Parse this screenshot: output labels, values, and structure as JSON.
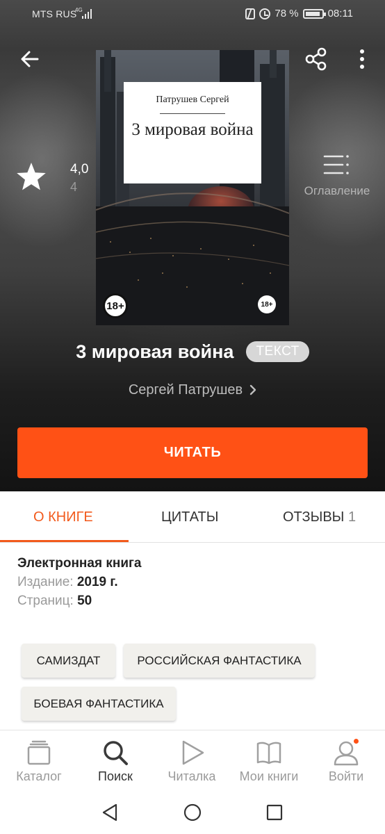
{
  "status_bar": {
    "carrier": "MTS RUS",
    "network": "4G",
    "battery": "78 %",
    "time": "08:11"
  },
  "rating": {
    "value": "4,0",
    "count": "4"
  },
  "toc": {
    "label": "Оглавление"
  },
  "cover": {
    "author": "Патрушев Сергей",
    "title": "3 мировая война",
    "age_badge": "18+",
    "age_badge_small": "18+"
  },
  "book": {
    "title": "3 мировая война",
    "format": "ТЕКСТ",
    "author": "Сергей Патрушев"
  },
  "read_button": "ЧИТАТЬ",
  "tabs": [
    {
      "label": "О КНИГЕ"
    },
    {
      "label": "ЦИТАТЫ"
    },
    {
      "label": "ОТЗЫВЫ",
      "count": "1"
    }
  ],
  "info": {
    "type": "Электронная книга",
    "edition_label": "Издание:",
    "edition_value": "2019 г.",
    "pages_label": "Страниц:",
    "pages_value": "50"
  },
  "genres": [
    "САМИЗДАТ",
    "РОССИЙСКАЯ ФАНТАСТИКА",
    "БОЕВАЯ ФАНТАСТИКА"
  ],
  "bottom_nav": [
    {
      "label": "Каталог",
      "icon": "catalog-icon"
    },
    {
      "label": "Поиск",
      "icon": "search-icon"
    },
    {
      "label": "Читалка",
      "icon": "play-icon"
    },
    {
      "label": "Мои книги",
      "icon": "book-icon"
    },
    {
      "label": "Войти",
      "icon": "user-icon"
    }
  ],
  "colors": {
    "accent": "#ff5115",
    "tab_active": "#f25a1c",
    "chip_bg": "#f1f0ec"
  }
}
